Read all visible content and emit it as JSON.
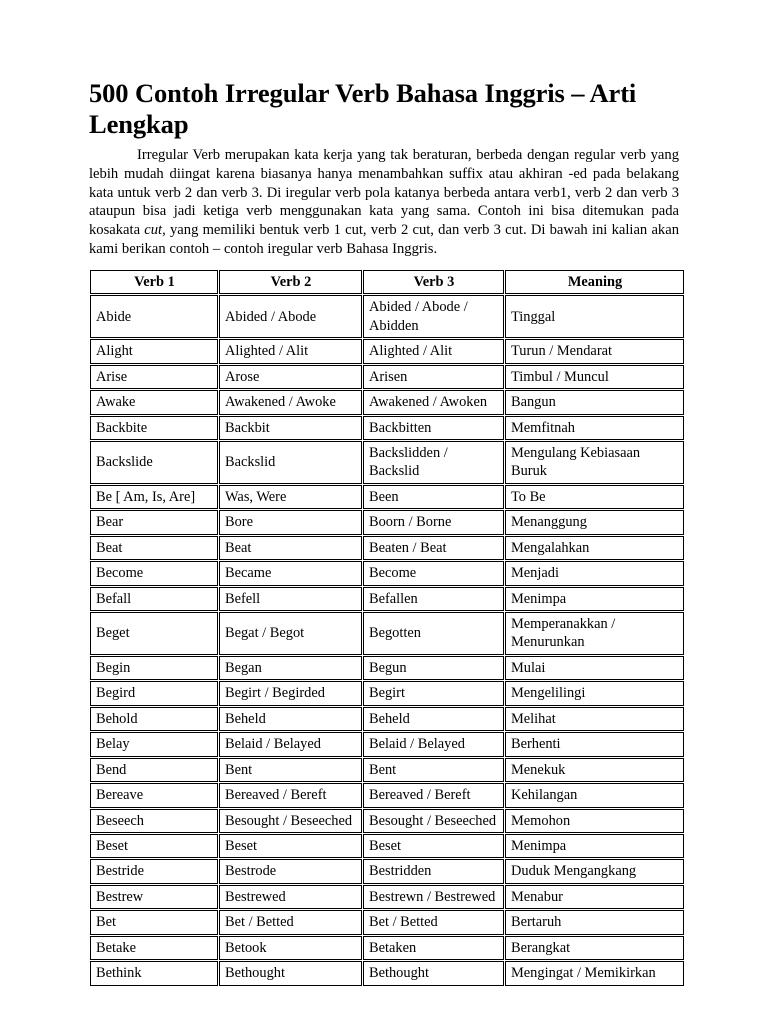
{
  "document": {
    "title": "500 Contoh Irregular Verb Bahasa Inggris – Arti Lengkap",
    "intro_before_italic": "Irregular Verb merupakan kata kerja yang tak beraturan, berbeda dengan regular verb yang lebih mudah diingat karena biasanya hanya menambahkan suffix atau akhiran -ed pada belakang kata untuk verb 2 dan verb 3. Di iregular verb pola katanya berbeda antara verb1, verb 2 dan verb 3 ataupun bisa jadi ketiga verb menggunakan kata yang sama. Contoh ini bisa ditemukan pada kosakata ",
    "intro_italic_word": "cut",
    "intro_after_italic": ", yang memiliki bentuk verb 1 cut, verb 2 cut, dan verb 3 cut. Di bawah ini kalian akan kami berikan contoh – contoh iregular verb Bahasa Inggris."
  },
  "table": {
    "headers": [
      "Verb 1",
      "Verb 2",
      "Verb 3",
      "Meaning"
    ],
    "rows": [
      [
        "Abide",
        "Abided / Abode",
        "Abided / Abode / Abidden",
        "Tinggal"
      ],
      [
        "Alight",
        "Alighted / Alit",
        "Alighted / Alit",
        "Turun / Mendarat"
      ],
      [
        "Arise",
        "Arose",
        "Arisen",
        "Timbul / Muncul"
      ],
      [
        "Awake",
        "Awakened / Awoke",
        "Awakened / Awoken",
        "Bangun"
      ],
      [
        "Backbite",
        "Backbit",
        "Backbitten",
        "Memfitnah"
      ],
      [
        "Backslide",
        "Backslid",
        "Backslidden / Backslid",
        "Mengulang Kebiasaan Buruk"
      ],
      [
        "Be [ Am, Is, Are]",
        "Was, Were",
        "Been",
        "To Be"
      ],
      [
        "Bear",
        "Bore",
        "Boorn / Borne",
        "Menanggung"
      ],
      [
        "Beat",
        "Beat",
        "Beaten / Beat",
        "Mengalahkan"
      ],
      [
        "Become",
        "Became",
        "Become",
        "Menjadi"
      ],
      [
        "Befall",
        "Befell",
        "Befallen",
        "Menimpa"
      ],
      [
        "Beget",
        "Begat / Begot",
        "Begotten",
        "Memperanakkan / Menurunkan"
      ],
      [
        "Begin",
        "Began",
        "Begun",
        "Mulai"
      ],
      [
        "Begird",
        "Begirt / Begirded",
        "Begirt",
        "Mengelilingi"
      ],
      [
        "Behold",
        "Beheld",
        "Beheld",
        "Melihat"
      ],
      [
        "Belay",
        "Belaid / Belayed",
        "Belaid / Belayed",
        "Berhenti"
      ],
      [
        "Bend",
        "Bent",
        "Bent",
        "Menekuk"
      ],
      [
        "Bereave",
        "Bereaved / Bereft",
        "Bereaved / Bereft",
        "Kehilangan"
      ],
      [
        "Beseech",
        "Besought / Beseeched",
        "Besought / Beseeched",
        "Memohon"
      ],
      [
        "Beset",
        "Beset",
        "Beset",
        "Menimpa"
      ],
      [
        "Bestride",
        "Bestrode",
        "Bestridden",
        "Duduk Mengangkang"
      ],
      [
        "Bestrew",
        "Bestrewed",
        "Bestrewn / Bestrewed",
        "Menabur"
      ],
      [
        "Bet",
        "Bet / Betted",
        "Bet / Betted",
        "Bertaruh"
      ],
      [
        "Betake",
        "Betook",
        "Betaken",
        "Berangkat"
      ],
      [
        "Bethink",
        "Bethought",
        "Bethought",
        "Mengingat / Memikirkan"
      ]
    ]
  }
}
